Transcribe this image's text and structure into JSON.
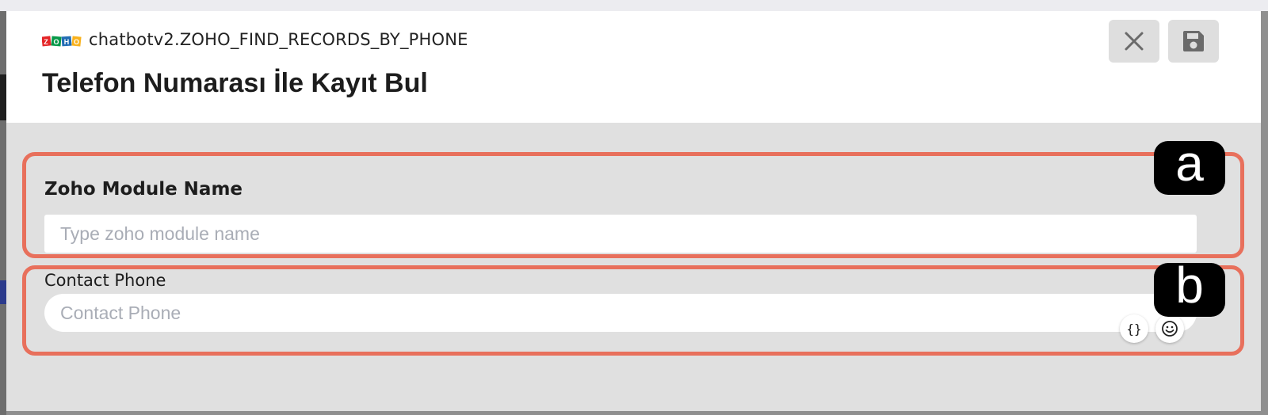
{
  "header": {
    "logo_text": "ZOHO",
    "action_id": "chatbotv2.ZOHO_FIND_RECORDS_BY_PHONE",
    "title": "Telefon Numarası İle Kayıt Bul",
    "close_icon": "close-icon",
    "save_icon": "save-icon"
  },
  "fields": {
    "module_name": {
      "label": "Zoho Module Name",
      "placeholder": "Type zoho module name",
      "value": ""
    },
    "contact_phone": {
      "label": "Contact Phone",
      "placeholder": "Contact Phone",
      "value": "",
      "variable_button": "{}",
      "variable_icon": "braces-icon",
      "emoji_icon": "smiley-icon"
    }
  },
  "annotations": {
    "a": "a",
    "b": "b"
  },
  "colors": {
    "highlight": "#e8705c",
    "badge_bg": "#000000",
    "modal_body": "#e0e0e0"
  }
}
